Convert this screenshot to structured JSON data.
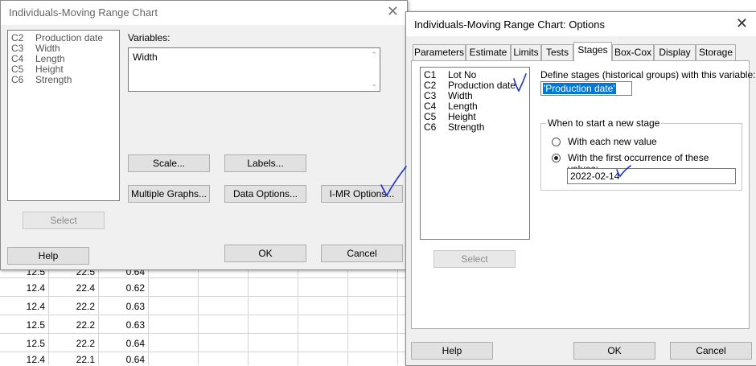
{
  "worksheet": {
    "rows": [
      [
        "12.5",
        "22.5",
        "0.64"
      ],
      [
        "12.4",
        "22.4",
        "0.62"
      ],
      [
        "12.4",
        "22.2",
        "0.63"
      ],
      [
        "12.5",
        "22.2",
        "0.63"
      ],
      [
        "12.5",
        "22.2",
        "0.64"
      ],
      [
        "12.4",
        "22.1",
        "0.64"
      ]
    ]
  },
  "main_dialog": {
    "title": "Individuals-Moving Range Chart",
    "columns": [
      {
        "id": "C2",
        "name": "Production date"
      },
      {
        "id": "C3",
        "name": "Width"
      },
      {
        "id": "C4",
        "name": "Length"
      },
      {
        "id": "C5",
        "name": "Height"
      },
      {
        "id": "C6",
        "name": "Strength"
      }
    ],
    "variables_label": "Variables:",
    "variables_value": "Width",
    "buttons": {
      "scale": "Scale...",
      "labels": "Labels...",
      "multiple_graphs": "Multiple Graphs...",
      "data_options": "Data Options...",
      "imr_options": "I-MR Options...",
      "select": "Select",
      "help": "Help",
      "ok": "OK",
      "cancel": "Cancel"
    }
  },
  "options_dialog": {
    "title": "Individuals-Moving Range Chart: Options",
    "tabs": [
      "Parameters",
      "Estimate",
      "Limits",
      "Tests",
      "Stages",
      "Box-Cox",
      "Display",
      "Storage"
    ],
    "active_tab": "Stages",
    "columns": [
      {
        "id": "C1",
        "name": "Lot No"
      },
      {
        "id": "C2",
        "name": "Production date"
      },
      {
        "id": "C3",
        "name": "Width"
      },
      {
        "id": "C4",
        "name": "Length"
      },
      {
        "id": "C5",
        "name": "Height"
      },
      {
        "id": "C6",
        "name": "Strength"
      }
    ],
    "define_stages_label": "Define stages (historical groups) with this variable:",
    "stage_variable_value": "'Production date'",
    "group_title": "When to start a new stage",
    "radio_each_value": "With each new value",
    "radio_first_occurrence": "With the first occurrence of these values:",
    "radio_selected": "first_occurrence",
    "values_input": "2022-02-14",
    "buttons": {
      "select": "Select",
      "help": "Help",
      "ok": "OK",
      "cancel": "Cancel"
    }
  },
  "annotation_color": "#1a2fd6"
}
